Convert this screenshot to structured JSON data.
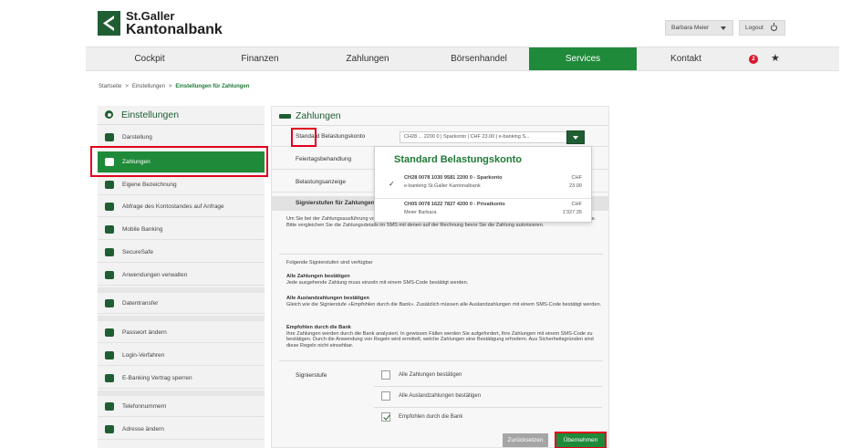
{
  "brand": {
    "line1": "St.Galler",
    "line2": "Kantonalbank",
    "color": "#1f5e33",
    "accent": "#1f8a3a"
  },
  "header": {
    "user_name": "Barbara Meier",
    "logout_label": "Logout"
  },
  "nav": {
    "items": [
      {
        "label": "Cockpit"
      },
      {
        "label": "Finanzen"
      },
      {
        "label": "Zahlungen"
      },
      {
        "label": "Börsenhandel"
      },
      {
        "label": "Services"
      },
      {
        "label": "Kontakt"
      }
    ],
    "active": "Services",
    "badge_count": "2"
  },
  "breadcrumb": {
    "items": [
      "Startseite",
      "Einstellungen",
      "Einstellungen für Zahlungen"
    ],
    "separator": ">"
  },
  "sidebar": {
    "title": "Einstellungen",
    "items": [
      {
        "label": "Darstellung",
        "icon": "gear-icon"
      },
      {
        "label": "Zahlungen",
        "icon": "payment-icon"
      },
      {
        "label": "Eigene Bezeichnung",
        "icon": "tag-icon"
      },
      {
        "label": "Abfrage des Kontostandes auf Anfrage",
        "icon": "phone-icon"
      },
      {
        "label": "Mobile Banking",
        "icon": "mobile-icon"
      },
      {
        "label": "SecureSafe",
        "icon": "safe-icon"
      },
      {
        "label": "Anwendungen verwalten",
        "icon": "apps-icon"
      },
      {
        "label": "Datentransfer",
        "icon": "transfer-icon"
      },
      {
        "label": "Passwort ändern",
        "icon": "key-icon"
      },
      {
        "label": "Login-Verfahren",
        "icon": "login-icon"
      },
      {
        "label": "E-Banking Vertrag sperren",
        "icon": "lock-icon"
      },
      {
        "label": "Telefonnummern",
        "icon": "telephone-icon"
      },
      {
        "label": "Adresse ändern",
        "icon": "location-icon"
      }
    ]
  },
  "main": {
    "title": "Zahlungen",
    "rows": {
      "standard_konto_label": "Standard Belastungskonto",
      "standard_konto_value": "CH28 ... 2200 0 | Sparkonto | CHF 23.00 | e-banking S...",
      "feiertag_label": "Feiertagsbehandlung",
      "belastungsanzeige_label": "Belastungsanzeige"
    },
    "signier_section_title": "Signierstufen für Zahlungen",
    "intro_text": "Um Sie bei der Zahlungsausführung vor Internetkriminellen zu schützen, erfordern einige Zahlungen eine Bestätigung mittels SMS-Code. Bitte vergleichen Sie die Zahlungsdetails im SMS mit denen auf der Rechnung bevor Sie die Zahlung autorisieren.",
    "levels_intro": "Folgende Signierstufen sind verfügbar",
    "levels": [
      {
        "title": "Alle Zahlungen bestätigen",
        "text": "Jede ausgehende Zahlung muss einzeln mit einem SMS-Code bestätigt werden."
      },
      {
        "title": "Alle Auslandzahlungen bestätigen",
        "text": "Gleich wie die Signierstufe «Empfohlen durch die Bank». Zusätzlich müssen alle Auslandzahlungen mit einem SMS-Code bestätigt werden."
      },
      {
        "title": "Empfohlen durch die Bank",
        "text": "Ihre Zahlungen werden durch die Bank analysiert. In gewissen Fällen werden Sie aufgefordert, Ihre Zahlungen mit einem SMS-Code zu bestätigen. Durch die Anwendung von Regeln wird ermittelt, welche Zahlungen eine Bestätigung erfordern. Aus Sicherheitsgründen sind diese Regeln nicht einsehbar."
      }
    ],
    "signierstufe_label": "Signierstufe",
    "options": [
      {
        "label": "Alle Zahlungen bestätigen",
        "checked": false
      },
      {
        "label": "Alle Auslandzahlungen bestätigen",
        "checked": false
      },
      {
        "label": "Empfohlen durch die Bank",
        "checked": true
      }
    ],
    "reset_label": "Zurücksetzen",
    "submit_label": "Übernehmen"
  },
  "dropdown": {
    "title": "Standard Belastungskonto",
    "options": [
      {
        "line1": "CH28 0078 1030 9581 2200 0 - Sparkonto",
        "line2": "e-banking St.Galler Kantonalbank",
        "currency": "CHF",
        "amount": "23.00",
        "selected": true
      },
      {
        "line1": "CH05 0078 1622 7827 4200 0 - Privatkonto",
        "line2": "Meier Barbara",
        "currency": "CHF",
        "amount": "1'327.35",
        "selected": false
      }
    ]
  }
}
